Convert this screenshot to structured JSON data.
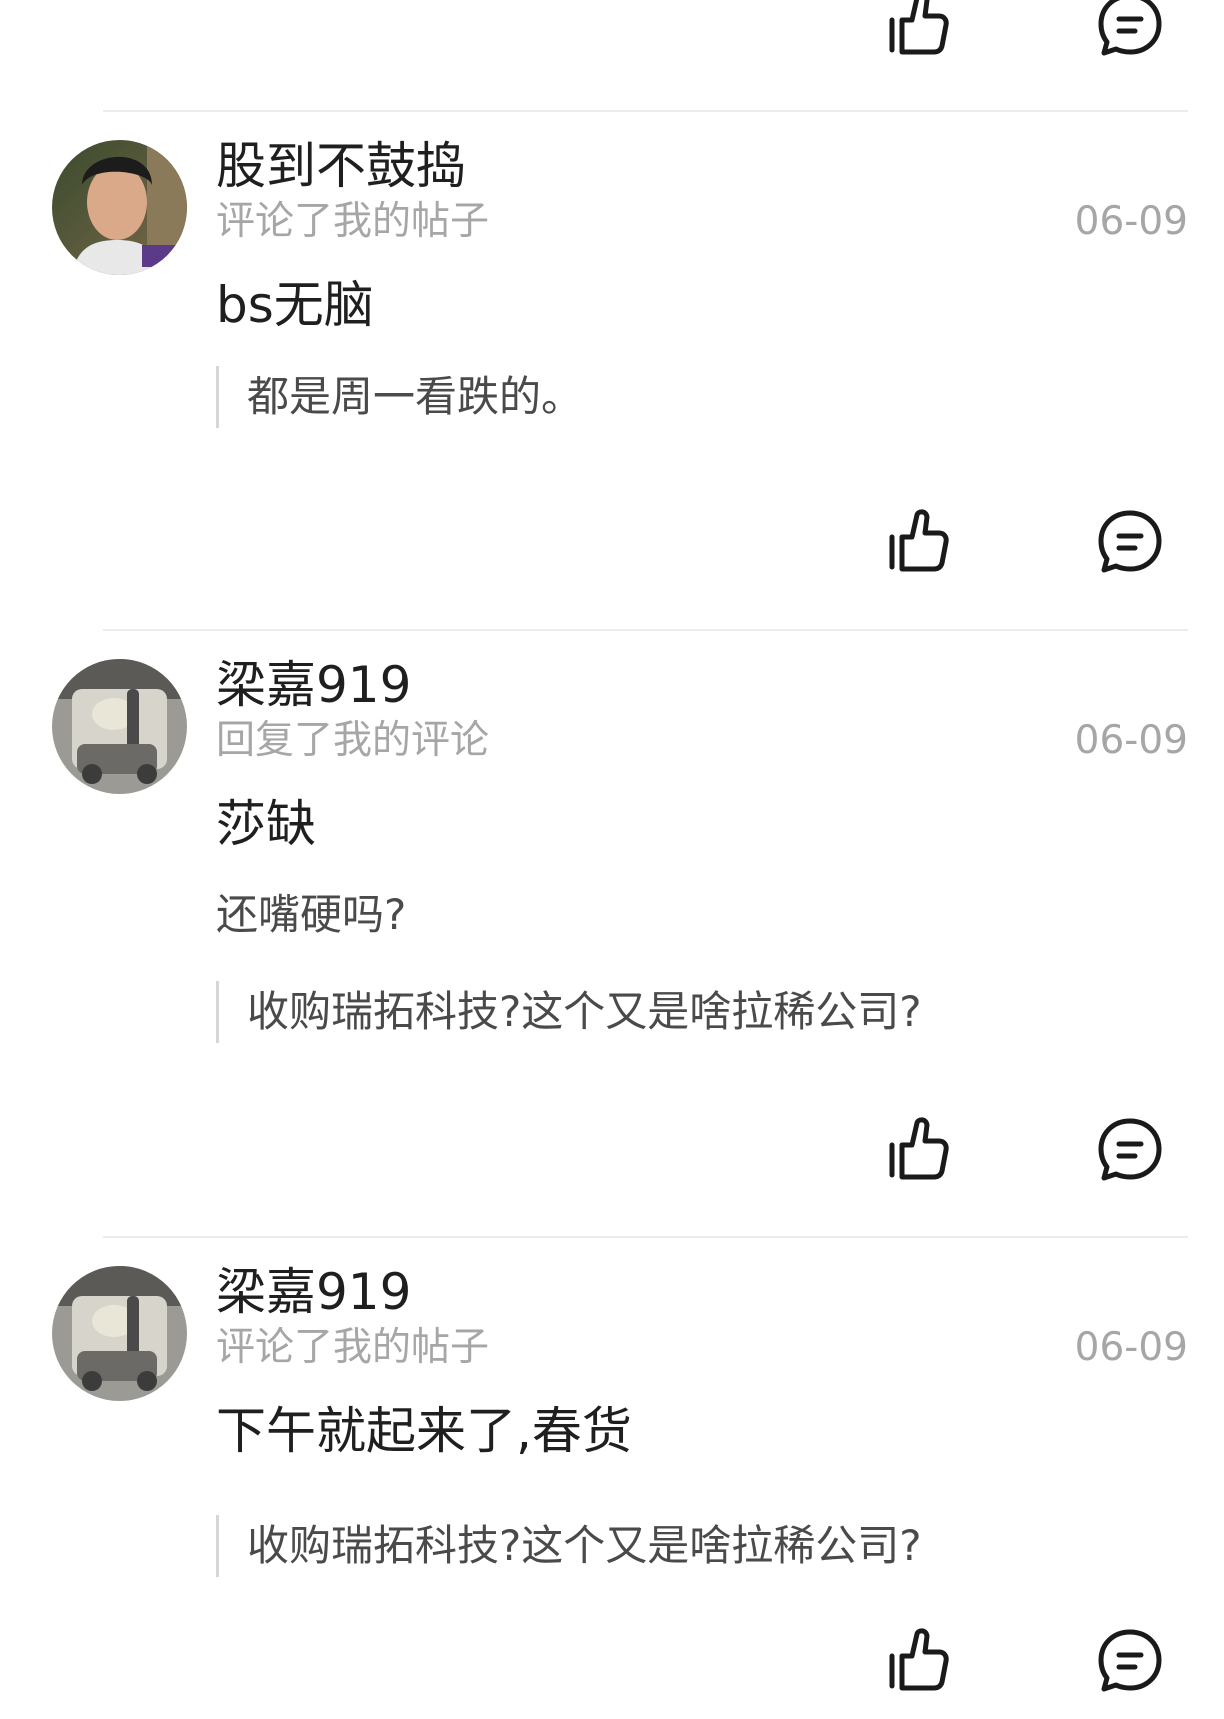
{
  "items": [
    {
      "username": "股到不鼓捣",
      "action": "评论了我的帖子",
      "date": "06-09",
      "content": "bs无脑",
      "reply": "",
      "quote": "都是周一看跌的。"
    },
    {
      "username": "梁嘉919",
      "action": "回复了我的评论",
      "date": "06-09",
      "content": "莎缺",
      "reply": "还嘴硬吗?",
      "quote": "收购瑞拓科技?这个又是啥拉稀公司?"
    },
    {
      "username": "梁嘉919",
      "action": "评论了我的帖子",
      "date": "06-09",
      "content": "下午就起来了,春货",
      "reply": "",
      "quote": "收购瑞拓科技?这个又是啥拉稀公司?"
    }
  ],
  "icons": {
    "like": "thumbs-up-icon",
    "comment": "comment-icon"
  },
  "colors": {
    "primary_text": "#1f1f1f",
    "secondary_text": "#a6a6a6",
    "quote_text": "#4a4a4a",
    "divider": "#ececec",
    "icon_stroke": "#1a1a1a"
  }
}
